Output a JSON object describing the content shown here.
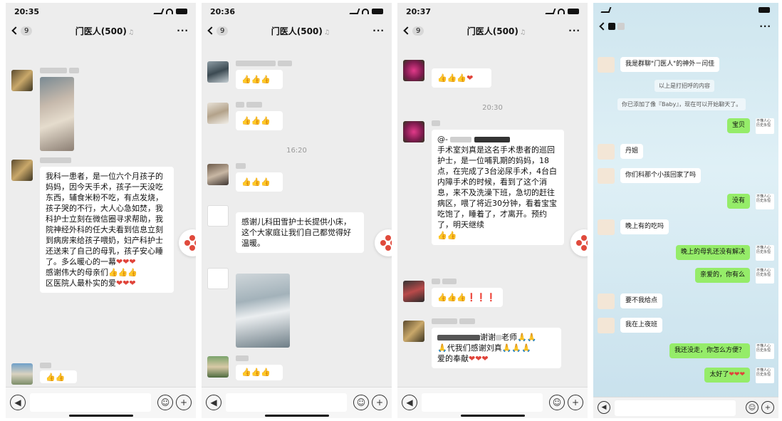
{
  "panels": [
    {
      "time": "20:35",
      "back_count": "9",
      "title": "门医人(500)",
      "messages": {
        "m1_text": "我科一患者，是一位六个月孩子的妈妈，因今天手术，孩子一天没吃东西，辅食米粉不吃，有点发烧，孩子哭的不行，大人心急如焚，我科护士立刻在微信圈寻求帮助，我院神经外科的任大夫看到信息立刻到病房来给孩子喂奶，妇产科护士还送来了自己的母乳，孩子安心睡了。多么暖心的一幕",
        "m1_text_b": "感谢伟大的母亲们",
        "m1_text_c": "区医院人最朴实的爱"
      }
    },
    {
      "time": "20:36",
      "back_count": "9",
      "title": "门医人(500)",
      "timestamp": "16:20",
      "messages": {
        "m4_text": "感谢儿科田雪护士长提供小床，这个大家庭让我们自己都觉得好温暖。"
      }
    },
    {
      "time": "20:37",
      "back_count": "9",
      "title": "门医人(500)",
      "timestamp": "20:30",
      "messages": {
        "m2_text_a": "@-",
        "m2_text_b": "手术室刘真是这名手术患者的巡回护士，是一位哺乳期的妈妈，18点，在完成了3台泌尿手术，4台白内障手术的时候，看到了这个消息，来不及洗澡下班，急切的赶往病区，喂了将近30分钟，看着宝宝吃饱了，睡着了，才离开。预约了，明天继续",
        "m4_text_a": "谢谢",
        "m4_text_b": "老师",
        "m4_text_c": "代我们感谢刘真",
        "m4_text_d": "爱的奉献"
      }
    },
    {
      "time": "",
      "messages": {
        "intro": "我是群聊\"门医人\"的神外－闫佳",
        "sys1": "以上是打招呼的内容",
        "sys2": "你已添加了像『Baby』，现在可以开始聊天了。",
        "r1": "宝贝",
        "l1": "丹姐",
        "l2": "你们科那个小孩回家了吗",
        "r2": "没有",
        "l3": "晚上有的吃吗",
        "r3": "晚上的母乳还没有解决",
        "r4": "亲爱的，你有么",
        "l4": "要不我给点",
        "l5": "我在上夜班",
        "r5": "我还没走，你怎么方便？",
        "r6": "太好了",
        "avatar_text": "不懂人心 历史永恒"
      }
    }
  ],
  "icons": {
    "thumb": "👍",
    "heart": "❤",
    "fist": "✊",
    "hands": "🙏",
    "exclaim": "❗"
  }
}
